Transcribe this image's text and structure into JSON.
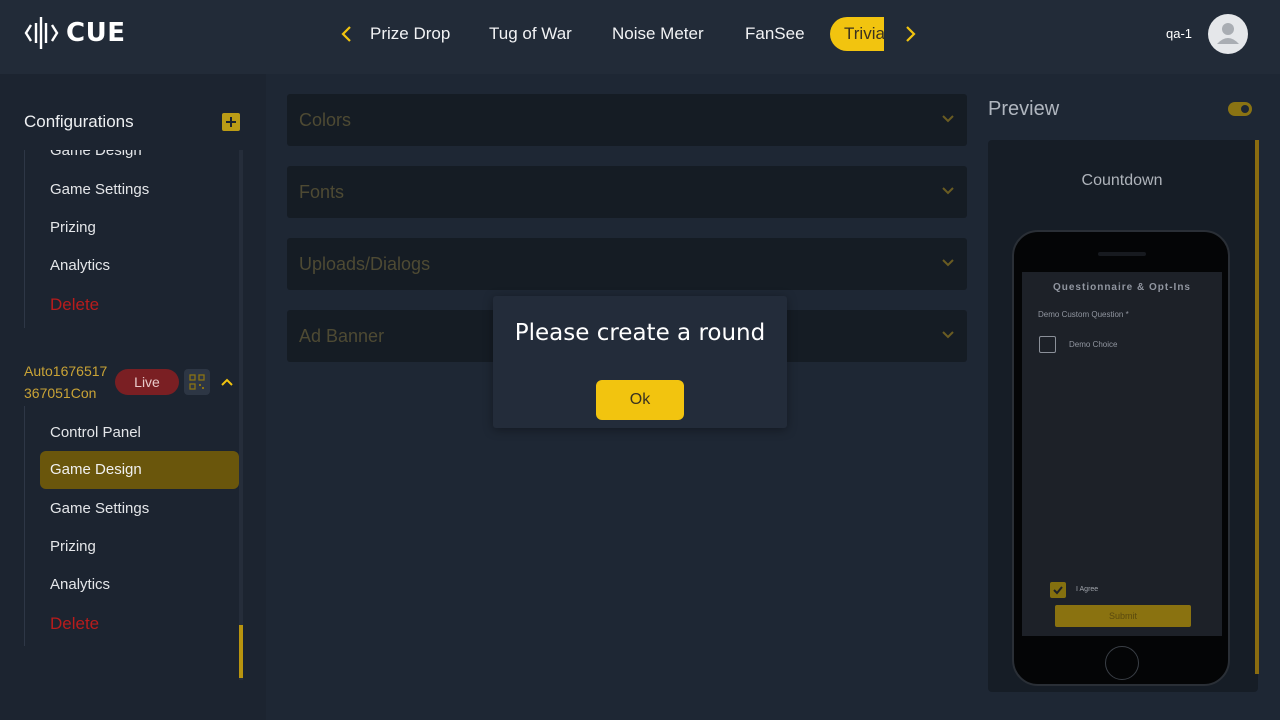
{
  "brand": {
    "logo_text": "CUE"
  },
  "nav": {
    "tabs": [
      {
        "label": "Prize Drop"
      },
      {
        "label": "Tug of War"
      },
      {
        "label": "Noise Meter"
      },
      {
        "label": "FanSee"
      },
      {
        "label": "Trivia",
        "active": true
      }
    ]
  },
  "user": {
    "name": "qa-1"
  },
  "sidebar": {
    "title": "Configurations",
    "group1": {
      "items": [
        "Game Design",
        "Game Settings",
        "Prizing",
        "Analytics"
      ],
      "delete_label": "Delete"
    },
    "group2": {
      "config_name": "Auto1676517367051Con",
      "status_badge": "Live",
      "items": [
        "Control Panel",
        "Game Design",
        "Game Settings",
        "Prizing",
        "Analytics"
      ],
      "active_item": "Game Design",
      "delete_label": "Delete"
    }
  },
  "main": {
    "accordions": [
      "Colors",
      "Fonts",
      "Uploads/Dialogs",
      "Ad Banner"
    ]
  },
  "preview": {
    "title": "Preview",
    "toggle_on": true,
    "screen_label": "Countdown",
    "questionnaire": {
      "title": "Questionnaire & Opt-Ins",
      "question_label": "Demo Custom Question *",
      "choice_label": "Demo Choice",
      "agree_label": "I Agree",
      "agree_checked": true,
      "submit_label": "Submit"
    }
  },
  "modal": {
    "message": "Please create a round",
    "ok_label": "Ok"
  },
  "colors": {
    "accent": "#f2c40f",
    "live_badge": "#7a1f23",
    "delete": "#b81c1c"
  }
}
